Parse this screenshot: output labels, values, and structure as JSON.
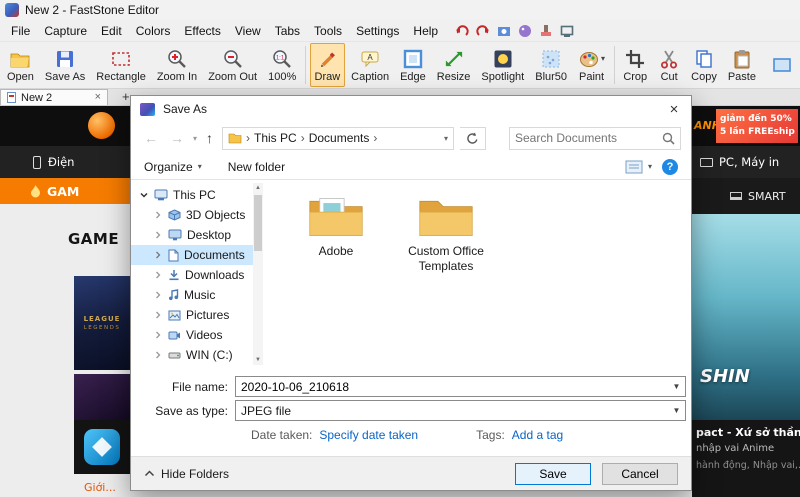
{
  "window": {
    "title": "New 2 - FastStone Editor"
  },
  "menu": {
    "items": [
      "File",
      "Capture",
      "Edit",
      "Colors",
      "Effects",
      "View",
      "Tabs",
      "Tools",
      "Settings",
      "Help"
    ]
  },
  "toolbar": {
    "buttons": [
      "Open",
      "Save As",
      "Rectangle",
      "Zoom In",
      "Zoom Out",
      "100%",
      "Draw",
      "Caption",
      "Edge",
      "Resize",
      "Spotlight",
      "Blur50",
      "Paint",
      "Crop",
      "Cut",
      "Copy",
      "Paste"
    ]
  },
  "tabbar": {
    "active_tab": "New 2"
  },
  "dialog": {
    "title": "Save As",
    "nav": {
      "breadcrumb_root": "This PC",
      "breadcrumb_folder": "Documents",
      "search_placeholder": "Search Documents"
    },
    "commands": {
      "organize": "Organize",
      "new_folder": "New folder"
    },
    "sidebar": [
      "This PC",
      "3D Objects",
      "Desktop",
      "Documents",
      "Downloads",
      "Music",
      "Pictures",
      "Videos",
      "WIN (C:)"
    ],
    "folders": [
      "Adobe",
      "Custom Office Templates"
    ],
    "fields": {
      "file_name_label": "File name:",
      "file_name_value": "2020-10-06_210618",
      "save_type_label": "Save as type:",
      "save_type_value": "JPEG file",
      "date_taken_label": "Date taken:",
      "date_taken_link": "Specify date taken",
      "tags_label": "Tags:",
      "tags_link": "Add a tag"
    },
    "footer": {
      "hide_folders": "Hide Folders",
      "save": "Save",
      "cancel": "Cancel"
    }
  },
  "webpage": {
    "left": {
      "category": "Điện",
      "nav_item": "GAM",
      "heading": "GAME",
      "thumb_text_1": "LEAGUE",
      "thumb_text_2": "LEGENDS",
      "footer_link": "Giới..."
    },
    "right": {
      "logo": "ANH",
      "promo_line1": "giảm đến 50%",
      "promo_line2": "5 lần FREEship",
      "category": "PC, Máy in",
      "menu_item": "SMART",
      "art_text": "SHIN",
      "game_title": "pact - Xứ sở thần",
      "game_subtitle": "nhập vai Anime",
      "game_tags": "hành động, Nhập vai,..."
    }
  }
}
